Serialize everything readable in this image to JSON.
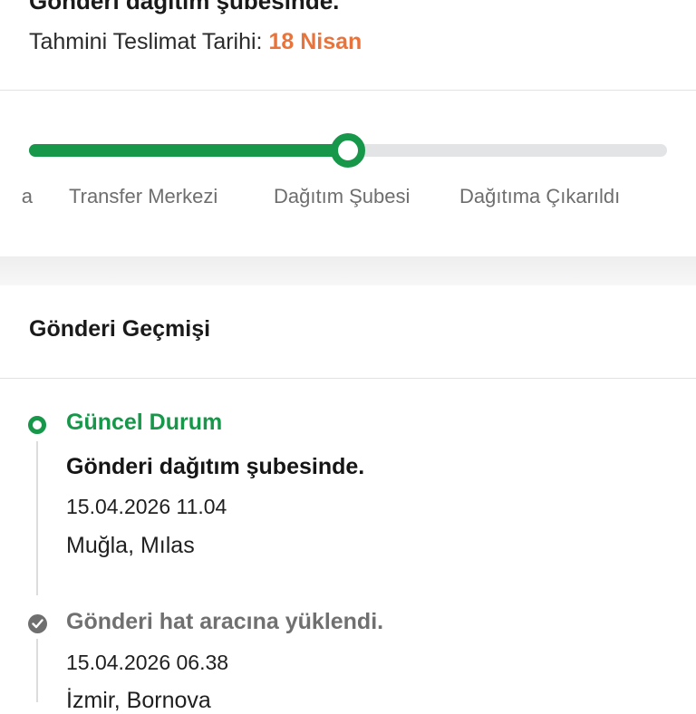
{
  "header": {
    "clipped_title": "Gönderi dağıtım şubesinde.",
    "eta_label": "Tahmini Teslimat Tarihi:",
    "eta_value": "18 Nisan"
  },
  "progress": {
    "completed_fraction": 0.5,
    "stages": [
      {
        "label": "a"
      },
      {
        "label": "Transfer Merkezi"
      },
      {
        "label": "Dağıtım Şubesi"
      },
      {
        "label": "Dağıtıma Çıkarıldı"
      }
    ],
    "colors": {
      "done": "#17974a",
      "pending": "#e3e4e6"
    }
  },
  "history": {
    "title": "Gönderi Geçmişi",
    "events": [
      {
        "status_label": "Güncel Durum",
        "description": "Gönderi dağıtım şubesinde.",
        "datetime": "15.04.2026 11.04",
        "location": "Muğla, Mılas",
        "icon": "current-status-ring-icon"
      },
      {
        "description": "Gönderi hat aracına yüklendi.",
        "datetime": "15.04.2026 06.38",
        "location": "İzmir, Bornova",
        "icon": "check-circle-icon"
      }
    ]
  },
  "colors": {
    "accent_green": "#17974a",
    "eta_orange": "#e8743b"
  }
}
